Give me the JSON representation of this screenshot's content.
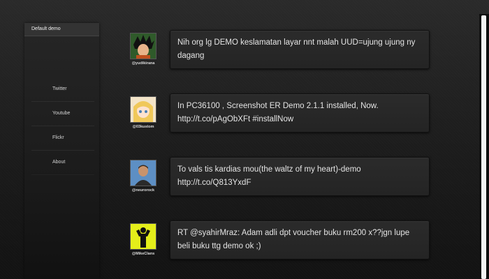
{
  "sidebar": {
    "title": "Default demo",
    "items": [
      {
        "label": "Twitter"
      },
      {
        "label": "Youtube"
      },
      {
        "label": "Flickr"
      },
      {
        "label": "About"
      }
    ]
  },
  "tweets": [
    {
      "handle": "@yudikirana",
      "text": "Nih org lg DEMO keslamatan layar nnt malah UUD=ujung ujung ny dagang"
    },
    {
      "handle": "@03kustom",
      "text": "In PC36100 , Screenshot ER Demo 2.1.1 installed, Now. http://t.co/pAgObXFt #installNow"
    },
    {
      "handle": "@neurorock",
      "text": "To vals tis kardias mou(the waltz of my heart)-demo http://t.co/Q813YxdF"
    },
    {
      "handle": "@MikeClans",
      "text": "RT @syahirMraz: Adam adli dpt voucher buku rm200 x??jgn lupe beli buku ttg demo ok ;)"
    }
  ]
}
